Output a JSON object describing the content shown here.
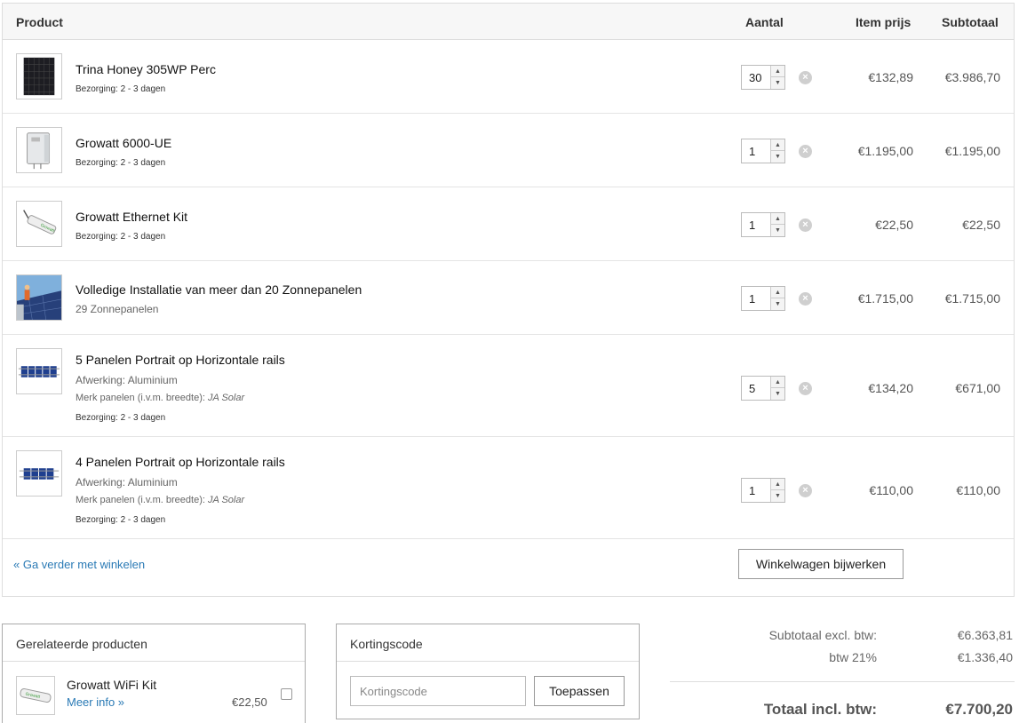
{
  "table": {
    "headers": {
      "product": "Product",
      "qty": "Aantal",
      "item_price": "Item prijs",
      "subtotal": "Subtotaal"
    },
    "rows": [
      {
        "name": "Trina Honey 305WP Perc",
        "delivery": "Bezorging: 2 - 3 dagen",
        "qty": "30",
        "price": "€132,89",
        "subtotal": "€3.986,70",
        "thumb_icon": "solar-panel-icon"
      },
      {
        "name": "Growatt 6000-UE",
        "delivery": "Bezorging: 2 - 3 dagen",
        "qty": "1",
        "price": "€1.195,00",
        "subtotal": "€1.195,00",
        "thumb_icon": "inverter-icon"
      },
      {
        "name": "Growatt Ethernet Kit",
        "delivery": "Bezorging: 2 - 3 dagen",
        "qty": "1",
        "price": "€22,50",
        "subtotal": "€22,50",
        "thumb_icon": "ethernet-kit-icon"
      },
      {
        "name": "Volledige Installatie van meer dan 20 Zonnepanelen",
        "sub": "29 Zonnepanelen",
        "qty": "1",
        "price": "€1.715,00",
        "subtotal": "€1.715,00",
        "thumb_icon": "installation-photo-icon"
      },
      {
        "name": "5 Panelen Portrait op Horizontale rails",
        "finish": "Afwerking: Aluminium",
        "brand_label": "Merk panelen (i.v.m. breedte):",
        "brand_value": "JA Solar",
        "delivery": "Bezorging: 2 - 3 dagen",
        "qty": "5",
        "price": "€134,20",
        "subtotal": "€671,00",
        "thumb_icon": "mounting-rails-icon"
      },
      {
        "name": "4 Panelen Portrait op Horizontale rails",
        "finish": "Afwerking: Aluminium",
        "brand_label": "Merk panelen (i.v.m. breedte):",
        "brand_value": "JA Solar",
        "delivery": "Bezorging: 2 - 3 dagen",
        "qty": "1",
        "price": "€110,00",
        "subtotal": "€110,00",
        "thumb_icon": "mounting-rails-icon"
      }
    ],
    "remove_glyph": "×",
    "spin_up": "▲",
    "spin_down": "▼"
  },
  "actions": {
    "continue_shopping": "« Ga verder met winkelen",
    "update_cart": "Winkelwagen bijwerken"
  },
  "related": {
    "title": "Gerelateerde producten",
    "item": {
      "name": "Growatt WiFi Kit",
      "more": "Meer info »",
      "price": "€22,50",
      "checked": false
    }
  },
  "coupon": {
    "title": "Kortingscode",
    "placeholder": "Kortingscode",
    "apply": "Toepassen"
  },
  "totals": {
    "subtotal_label": "Subtotaal excl. btw:",
    "subtotal_value": "€6.363,81",
    "vat_label": "btw 21%",
    "vat_value": "€1.336,40",
    "total_label": "Totaal incl. btw:",
    "total_value": "€7.700,20"
  },
  "colors": {
    "link": "#2a7ab5",
    "border": "#dddddd",
    "header_bg": "#f7f7f7"
  }
}
